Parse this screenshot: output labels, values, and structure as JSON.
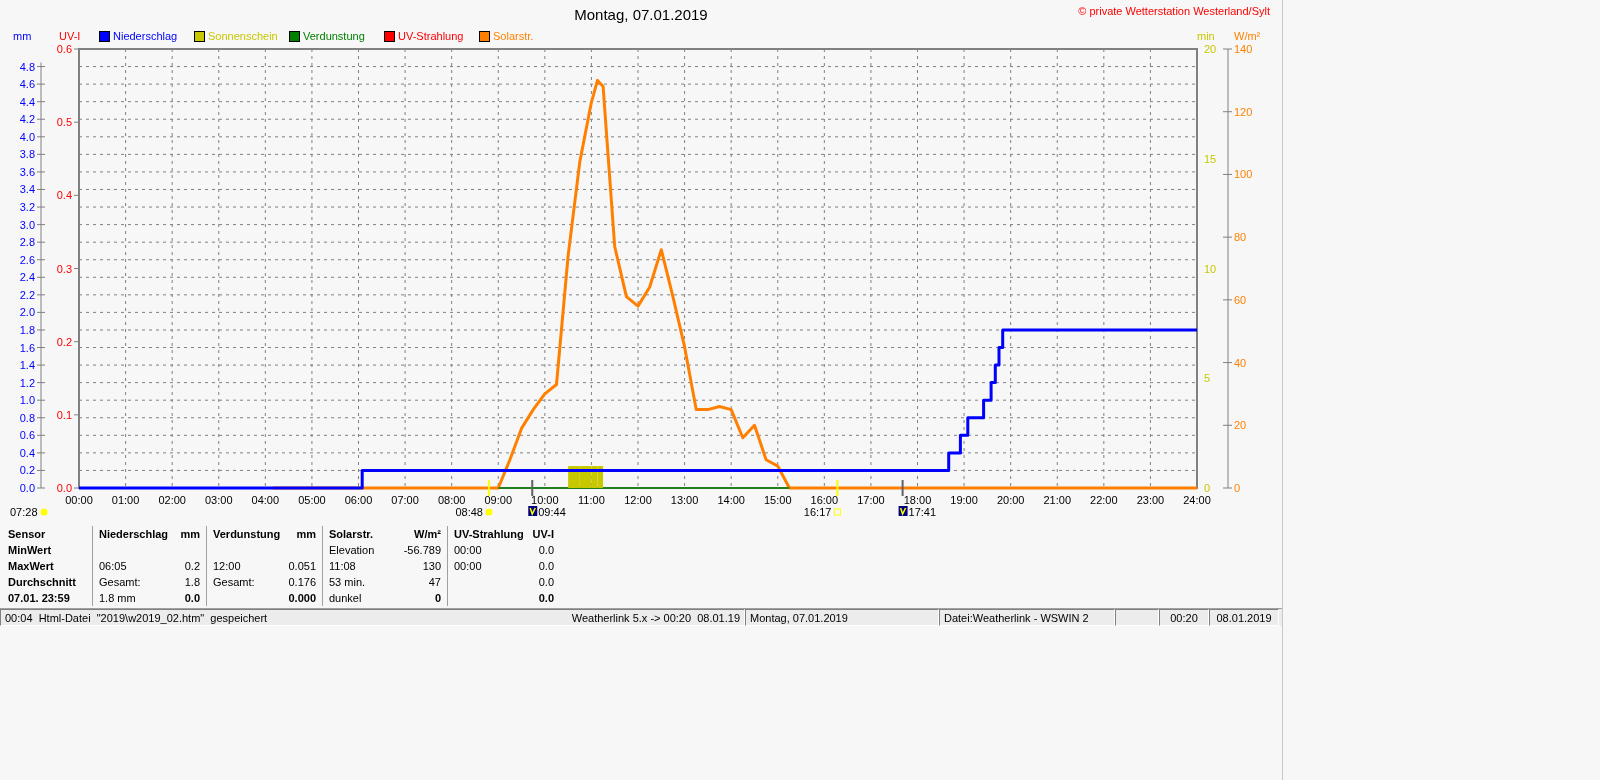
{
  "title": "Montag, 07.01.2019",
  "copyright": "© private Wetterstation Westerland/Sylt",
  "uv_axis": {
    "label": "UV-I",
    "ticks": [
      "0.6",
      "0.5",
      "0.4",
      "0.3",
      "0.2",
      "0.1",
      "0.0"
    ]
  },
  "chart_data": {
    "type": "line",
    "ylabel": "mm",
    "ylim": [
      0,
      5
    ],
    "yticks": [
      {
        "value": 0,
        "label": "0.0"
      },
      {
        "value": 0.2,
        "label": "0.2"
      },
      {
        "value": 0.4,
        "label": "0.4"
      },
      {
        "value": 0.6,
        "label": "0.6"
      },
      {
        "value": 0.8,
        "label": "0.8"
      },
      {
        "value": 1,
        "label": "1.0"
      },
      {
        "value": 1.2,
        "label": "1.2"
      },
      {
        "value": 1.4,
        "label": "1.4"
      },
      {
        "value": 1.6,
        "label": "1.6"
      },
      {
        "value": 1.8,
        "label": "1.8"
      },
      {
        "value": 2,
        "label": "2.0"
      },
      {
        "value": 2.2,
        "label": "2.2"
      },
      {
        "value": 2.4,
        "label": "2.4"
      },
      {
        "value": 2.6,
        "label": "2.6"
      },
      {
        "value": 2.8,
        "label": "2.8"
      },
      {
        "value": 3,
        "label": "3.0"
      },
      {
        "value": 3.2,
        "label": "3.2"
      },
      {
        "value": 3.4,
        "label": "3.4"
      },
      {
        "value": 3.6,
        "label": "3.6"
      },
      {
        "value": 3.8,
        "label": "3.8"
      },
      {
        "value": 4,
        "label": "4.0"
      },
      {
        "value": 4.2,
        "label": "4.2"
      },
      {
        "value": 4.4,
        "label": "4.4"
      },
      {
        "value": 4.6,
        "label": "4.6"
      },
      {
        "value": 4.8,
        "label": "4.8"
      }
    ],
    "y2label": "W/m²",
    "y2lim": [
      0,
      140
    ],
    "y2ticks": [
      0,
      20,
      40,
      60,
      80,
      100,
      120,
      140
    ],
    "y3label": "min",
    "y3lim": [
      0,
      20
    ],
    "y3ticks": [
      0,
      5,
      10,
      15,
      20
    ],
    "xlim": [
      0,
      24
    ],
    "xticks": [
      {
        "value": 0,
        "label": "00:00"
      },
      {
        "value": 1,
        "label": "01:00"
      },
      {
        "value": 2,
        "label": "02:00"
      },
      {
        "value": 3,
        "label": "03:00"
      },
      {
        "value": 4,
        "label": "04:00"
      },
      {
        "value": 5,
        "label": "05:00"
      },
      {
        "value": 6,
        "label": "06:00"
      },
      {
        "value": 7,
        "label": "07:00"
      },
      {
        "value": 8,
        "label": "08:00"
      },
      {
        "value": 9,
        "label": "09:00"
      },
      {
        "value": 10,
        "label": "10:00"
      },
      {
        "value": 11,
        "label": "11:00"
      },
      {
        "value": 12,
        "label": "12:00"
      },
      {
        "value": 13,
        "label": "13:00"
      },
      {
        "value": 14,
        "label": "14:00"
      },
      {
        "value": 15,
        "label": "15:00"
      },
      {
        "value": 16,
        "label": "16:00"
      },
      {
        "value": 17,
        "label": "17:00"
      },
      {
        "value": 18,
        "label": "18:00"
      },
      {
        "value": 19,
        "label": "19:00"
      },
      {
        "value": 20,
        "label": "20:00"
      },
      {
        "value": 21,
        "label": "21:00"
      },
      {
        "value": 22,
        "label": "22:00"
      },
      {
        "value": 23,
        "label": "23:00"
      },
      {
        "value": 24,
        "label": "24:00"
      }
    ],
    "x": [
      0,
      4.17,
      6.08,
      6.08,
      9,
      9.25,
      9.5,
      9.75,
      10,
      10.25,
      10.5,
      10.75,
      11,
      11.13,
      11.25,
      11.5,
      11.75,
      12,
      12.25,
      12.5,
      12.75,
      13,
      13.25,
      13.5,
      13.75,
      14,
      14.25,
      14.5,
      14.75,
      15,
      15.25,
      18.67,
      18.67,
      18.92,
      18.92,
      19.08,
      19.08,
      19.42,
      19.42,
      19.58,
      19.58,
      19.67,
      19.67,
      19.75,
      19.75,
      19.83,
      19.83,
      24
    ],
    "series": [
      {
        "name": "Niederschlag",
        "color": "#0000ff",
        "values": [
          0,
          0,
          0,
          0.2,
          0.2,
          0.2,
          0.2,
          0.2,
          0.2,
          0.2,
          0.2,
          0.2,
          0.2,
          0.2,
          0.2,
          0.2,
          0.2,
          0.2,
          0.2,
          0.2,
          0.2,
          0.2,
          0.2,
          0.2,
          0.2,
          0.2,
          0.2,
          0.2,
          0.2,
          0.2,
          0.2,
          0.2,
          0.4,
          0.4,
          0.6,
          0.6,
          0.8,
          0.8,
          1,
          1,
          1.2,
          1.2,
          1.4,
          1.4,
          1.6,
          1.6,
          1.8,
          1.8
        ]
      },
      {
        "name": "Sonnenschein",
        "color": "#c8c800",
        "axis": "y3",
        "type": "area",
        "values": [
          null,
          null,
          null,
          null,
          null,
          null,
          null,
          null,
          null,
          null,
          1,
          1,
          1,
          1,
          1,
          null,
          null,
          null,
          null,
          null,
          null,
          null,
          null,
          null,
          null,
          null,
          null,
          null,
          null,
          null,
          null,
          null,
          null,
          null,
          null,
          null,
          null,
          null,
          null,
          null,
          null,
          null,
          null,
          null,
          null,
          null,
          null,
          null
        ]
      },
      {
        "name": "Verdunstung",
        "color": "#008000",
        "values": [
          null,
          null,
          null,
          null,
          0,
          0,
          0,
          0,
          0,
          0,
          0,
          0,
          0,
          0,
          0,
          0,
          0,
          0,
          0,
          0,
          0,
          0,
          0,
          0,
          0,
          0,
          0,
          0,
          0,
          0,
          0,
          null,
          null,
          null,
          null,
          null,
          null,
          null,
          null,
          null,
          null,
          null,
          null,
          null,
          null,
          null,
          null,
          null
        ]
      },
      {
        "name": "UV-Strahlung",
        "color": "#ff0000",
        "values": [
          null,
          null,
          null,
          null,
          null,
          null,
          null,
          null,
          null,
          null,
          null,
          null,
          null,
          null,
          null,
          null,
          null,
          null,
          null,
          null,
          null,
          null,
          null,
          null,
          null,
          null,
          null,
          null,
          null,
          null,
          null,
          null,
          null,
          null,
          null,
          null,
          null,
          null,
          null,
          null,
          null,
          null,
          null,
          null,
          null,
          null,
          null,
          null
        ]
      },
      {
        "name": "Solarstr.",
        "color": "#ff8000",
        "axis": "y2",
        "values": [
          null,
          0,
          0,
          0,
          0,
          9,
          19,
          25,
          30,
          33,
          74,
          104,
          123,
          130,
          128,
          77,
          61,
          58,
          64,
          76,
          61,
          45,
          25,
          25,
          26,
          25,
          16,
          20,
          9,
          7,
          0,
          0,
          0,
          0,
          0,
          0,
          0,
          0,
          0,
          0,
          0,
          0,
          0,
          0,
          0,
          0,
          0,
          0
        ]
      }
    ],
    "grid": true
  },
  "daylight_events": [
    {
      "time": "07:28",
      "kind": "sun-edge"
    },
    {
      "time": "08:48",
      "kind": "sun"
    },
    {
      "time": "09:44",
      "kind": "moon"
    },
    {
      "time": "16:17",
      "kind": "sun-outline"
    },
    {
      "time": "17:41",
      "kind": "moon"
    }
  ],
  "sensor_column": {
    "header": "Sensor",
    "rows": [
      "MinWert",
      "MaxWert",
      "Durchschnitt",
      "07.01. 23:59"
    ]
  },
  "sensors": [
    {
      "name": "Niederschlag",
      "unit": "mm",
      "rows": [
        null,
        {
          "label": "06:05",
          "value": "0.2"
        },
        {
          "label": "Gesamt:",
          "value": "1.8"
        },
        {
          "label": "1.8 mm",
          "value": "0.0"
        }
      ]
    },
    {
      "name": "Verdunstung",
      "unit": "mm",
      "rows": [
        null,
        {
          "label": "12:00",
          "value": "0.051"
        },
        {
          "label": "Gesamt:",
          "value": "0.176"
        },
        {
          "value": "0.000"
        }
      ]
    },
    {
      "name": "Solarstr.",
      "unit": "W/m²",
      "rows": [
        {
          "label": "Elevation",
          "value": "-56.789"
        },
        {
          "label": "11:08",
          "value": "130"
        },
        {
          "label": "53 min.",
          "value": "47"
        },
        {
          "label": "dunkel",
          "value": "0"
        }
      ]
    },
    {
      "name": "UV-Strahlung",
      "unit": "UV-I",
      "rows": [
        {
          "label": "00:00",
          "value": "0.0"
        },
        {
          "label": "00:00",
          "value": "0.0"
        },
        {
          "value": "0.0"
        },
        {
          "value": "0.0"
        }
      ]
    }
  ],
  "status_bar": {
    "message": "00:04  Html-Datei  \"2019\\w2019_02.htm\"  gespeichert",
    "sync": "Weatherlink 5.x -> 00:20  08.01.19",
    "panels": [
      {
        "text": "Montag, 07.01.2019"
      },
      {
        "text": "Datei:Weatherlink - WSWIN 2"
      },
      {
        "text": "00:20"
      },
      {
        "text": "08.01.2019"
      }
    ]
  }
}
